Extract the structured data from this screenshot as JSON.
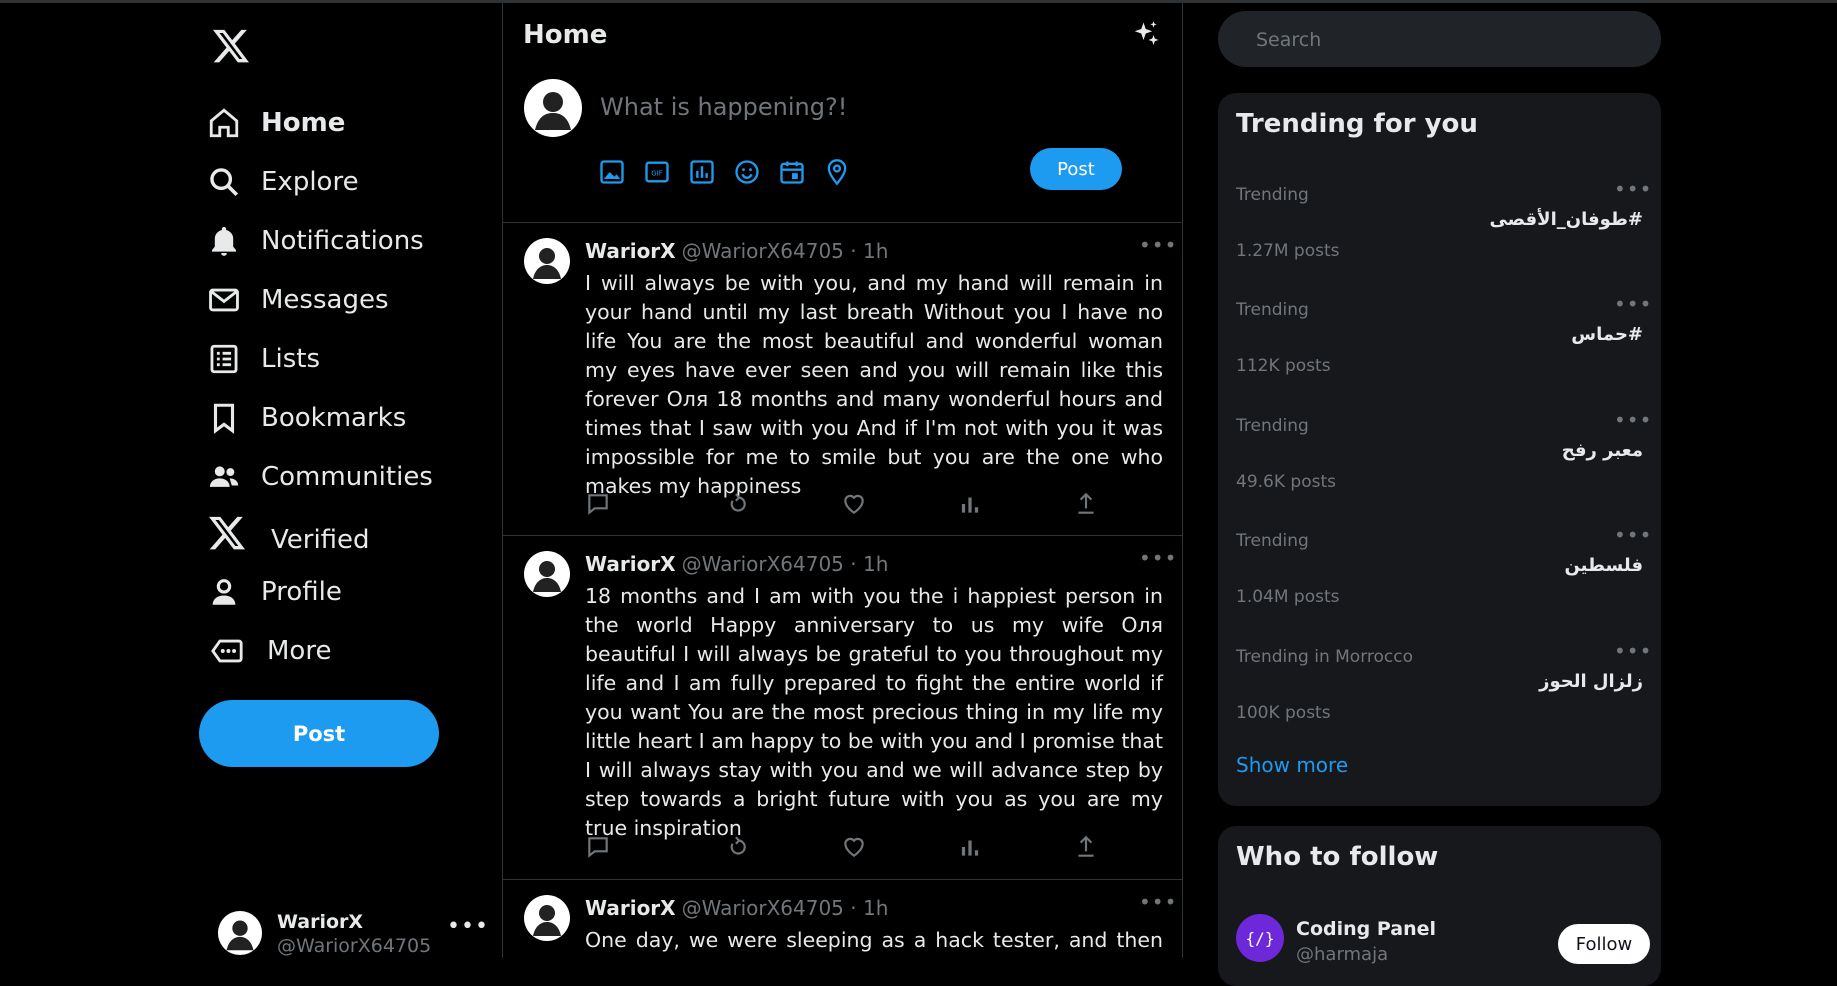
{
  "sidebar": {
    "nav": [
      {
        "label": "Home",
        "icon": "home-icon"
      },
      {
        "label": "Explore",
        "icon": "search-icon"
      },
      {
        "label": "Notifications",
        "icon": "bell-icon"
      },
      {
        "label": "Messages",
        "icon": "envelope-icon"
      },
      {
        "label": "Lists",
        "icon": "list-icon"
      },
      {
        "label": "Bookmarks",
        "icon": "bookmark-icon"
      },
      {
        "label": "Communities",
        "icon": "people-icon"
      },
      {
        "label": "Verified",
        "icon": "x-logo-icon"
      },
      {
        "label": "Profile",
        "icon": "person-icon"
      },
      {
        "label": "More",
        "icon": "more-circle-icon"
      }
    ],
    "post_label": "Post",
    "account": {
      "name": "WariorX",
      "handle": "@WariorX64705"
    }
  },
  "main": {
    "title": "Home",
    "composer": {
      "placeholder": "What is happening?!",
      "post_label": "Post"
    },
    "tweets": [
      {
        "name": "WariorX",
        "handle": "@WariorX64705 · 1h",
        "text": "I will always be with you, and my hand will remain in your hand until my last breath Without you I have no life You are the most beautiful and wonderful woman my eyes have ever seen and you will remain like this forever Оля 18 months and many wonderful hours and times that I saw with you And if I'm not with you it was impossible for me to smile but you are the one who makes my happiness"
      },
      {
        "name": "WariorX",
        "handle": "@WariorX64705 · 1h",
        "text": "18 months and I am with you the i happiest person in the world Happy anniversary to us my wife Оля beautiful I will always be grateful to you throughout my life and I am fully prepared to fight the entire world if you want You are the most precious thing in my life my little heart I am happy to be with you and I promise that I will always stay with you and we will advance step by step towards a bright future with you as you are my true inspiration"
      },
      {
        "name": "WariorX",
        "handle": "@WariorX64705 · 1h",
        "text": "One day, we were sleeping as a hack tester, and then we"
      }
    ]
  },
  "right": {
    "search_placeholder": "Search",
    "trending": {
      "title": "Trending for you",
      "items": [
        {
          "context": "Trending",
          "name": "#طوفان_الأقصى",
          "count": "1.27M posts"
        },
        {
          "context": "Trending",
          "name": "#حماس",
          "count": "112K posts"
        },
        {
          "context": "Trending",
          "name": "معبر رفح",
          "count": "49.6K posts"
        },
        {
          "context": "Trending",
          "name": "فلسطين",
          "count": "1.04M posts"
        },
        {
          "context": "Trending in Morrocco",
          "name": "زلزال الحوز",
          "count": "100K posts"
        }
      ],
      "show_more": "Show more"
    },
    "who_to_follow": {
      "title": "Who to follow",
      "items": [
        {
          "name": "Coding Panel",
          "handle": "@harmaja",
          "avatar_text": "{/}",
          "follow_label": "Follow"
        }
      ]
    }
  },
  "colors": {
    "accent": "#1d9bf0",
    "background": "#000000",
    "panel": "#16181c",
    "muted": "#71767b"
  }
}
